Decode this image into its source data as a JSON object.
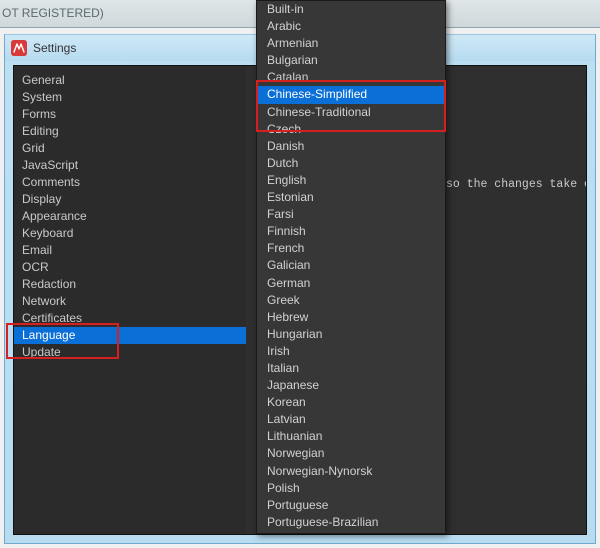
{
  "topstrip_text": "OT REGISTERED)",
  "window": {
    "title": "Settings"
  },
  "sidebar": {
    "items": [
      "General",
      "System",
      "Forms",
      "Editing",
      "Grid",
      "JavaScript",
      "Comments",
      "Display",
      "Appearance",
      "Keyboard",
      "Email",
      "OCR",
      "Redaction",
      "Network",
      "Certificates",
      "Language",
      "Update"
    ],
    "selected_index": 15
  },
  "content": {
    "restart_hint": "so the changes take effect."
  },
  "dropdown": {
    "items": [
      "Built-in",
      "Arabic",
      "Armenian",
      "Bulgarian",
      "Catalan",
      "Chinese-Simplified",
      "Chinese-Traditional",
      "Czech",
      "Danish",
      "Dutch",
      "English",
      "Estonian",
      "Farsi",
      "Finnish",
      "French",
      "Galician",
      "German",
      "Greek",
      "Hebrew",
      "Hungarian",
      "Irish",
      "Italian",
      "Japanese",
      "Korean",
      "Latvian",
      "Lithuanian",
      "Norwegian",
      "Norwegian-Nynorsk",
      "Polish",
      "Portuguese",
      "Portuguese-Brazilian"
    ],
    "selected_index": 5
  },
  "highlight": {
    "sidebar_item": "Language",
    "dropdown_range": [
      "Catalan",
      "Chinese-Simplified",
      "Chinese-Traditional"
    ]
  }
}
